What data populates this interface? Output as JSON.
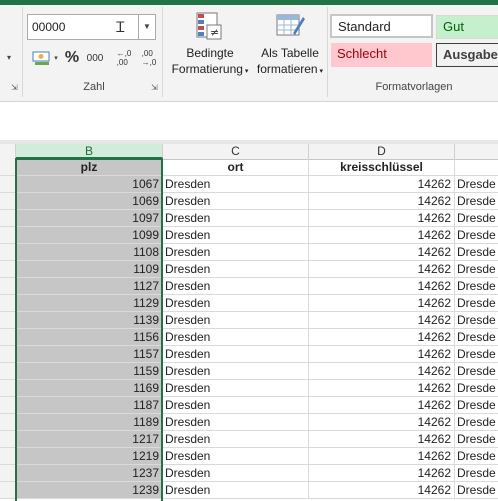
{
  "ribbon": {
    "number_format_value": "00000",
    "percent_symbol": "%",
    "thousands_symbol": "000",
    "decrease_decimal": "←,0\n,00",
    "increase_decimal": ",00\n→,0",
    "group_zahl": "Zahl",
    "conditional_formatting_line1": "Bedingte",
    "conditional_formatting_line2": "Formatierung",
    "format_as_table_line1": "Als Tabelle",
    "format_as_table_line2": "formatieren",
    "group_formatvorlagen": "Formatvorlagen",
    "styles": {
      "standard": "Standard",
      "gut": "Gut",
      "schlecht": "Schlecht",
      "ausgabe": "Ausgabe"
    },
    "colors": {
      "gut_bg": "#c6efce",
      "gut_fg": "#006100",
      "schlecht_bg": "#ffc7ce",
      "schlecht_fg": "#9c0006",
      "ausgabe_bg": "#f2f2f2",
      "accent": "#217346"
    }
  },
  "sheet": {
    "columns": [
      "B",
      "C",
      "D"
    ],
    "selected_column": "B",
    "header_row": {
      "b": "plz",
      "c": "ort",
      "d": "kreisschlüssel"
    },
    "rows": [
      {
        "b": "1067",
        "c": "Dresden",
        "d": "14262",
        "e": "Dresde"
      },
      {
        "b": "1069",
        "c": "Dresden",
        "d": "14262",
        "e": "Dresde"
      },
      {
        "b": "1097",
        "c": "Dresden",
        "d": "14262",
        "e": "Dresde"
      },
      {
        "b": "1099",
        "c": "Dresden",
        "d": "14262",
        "e": "Dresde"
      },
      {
        "b": "1108",
        "c": "Dresden",
        "d": "14262",
        "e": "Dresde"
      },
      {
        "b": "1109",
        "c": "Dresden",
        "d": "14262",
        "e": "Dresde"
      },
      {
        "b": "1127",
        "c": "Dresden",
        "d": "14262",
        "e": "Dresde"
      },
      {
        "b": "1129",
        "c": "Dresden",
        "d": "14262",
        "e": "Dresde"
      },
      {
        "b": "1139",
        "c": "Dresden",
        "d": "14262",
        "e": "Dresde"
      },
      {
        "b": "1156",
        "c": "Dresden",
        "d": "14262",
        "e": "Dresde"
      },
      {
        "b": "1157",
        "c": "Dresden",
        "d": "14262",
        "e": "Dresde"
      },
      {
        "b": "1159",
        "c": "Dresden",
        "d": "14262",
        "e": "Dresde"
      },
      {
        "b": "1169",
        "c": "Dresden",
        "d": "14262",
        "e": "Dresde"
      },
      {
        "b": "1187",
        "c": "Dresden",
        "d": "14262",
        "e": "Dresde"
      },
      {
        "b": "1189",
        "c": "Dresden",
        "d": "14262",
        "e": "Dresde"
      },
      {
        "b": "1217",
        "c": "Dresden",
        "d": "14262",
        "e": "Dresde"
      },
      {
        "b": "1219",
        "c": "Dresden",
        "d": "14262",
        "e": "Dresde"
      },
      {
        "b": "1237",
        "c": "Dresden",
        "d": "14262",
        "e": "Dresde"
      },
      {
        "b": "1239",
        "c": "Dresden",
        "d": "14262",
        "e": "Dresde"
      }
    ]
  }
}
